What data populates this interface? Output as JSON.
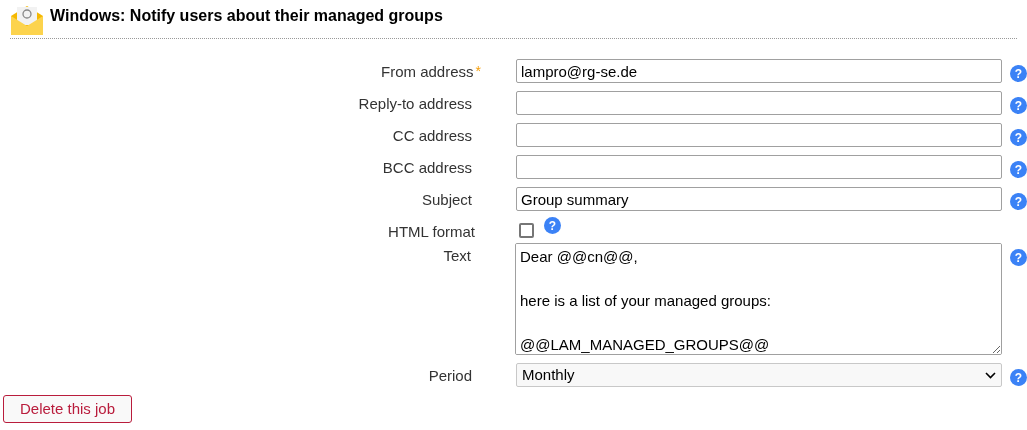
{
  "title": "Windows: Notify users about their managed groups",
  "fields": [
    {
      "kind": "text",
      "label": "From address",
      "required": true,
      "value": "lampro@rg-se.de"
    },
    {
      "kind": "text",
      "label": "Reply-to address",
      "required": false
    },
    {
      "kind": "text",
      "label": "CC address",
      "required": false
    },
    {
      "kind": "text",
      "label": "BCC address",
      "required": false
    },
    {
      "kind": "text",
      "label": "Subject",
      "required": false,
      "value": "Group summary"
    },
    {
      "kind": "checkbox",
      "label": "HTML format",
      "required": false,
      "checked": false
    },
    {
      "kind": "textarea",
      "label": "Text",
      "required": false,
      "value": "Dear @@cn@@,\n\nhere is a list of your managed groups:\n\n@@LAM_MANAGED_GROUPS@@"
    },
    {
      "kind": "select",
      "label": "Period",
      "required": false,
      "value": "Monthly"
    }
  ],
  "required_mark": "*",
  "help_mark": "?",
  "delete_button": "Delete this job"
}
